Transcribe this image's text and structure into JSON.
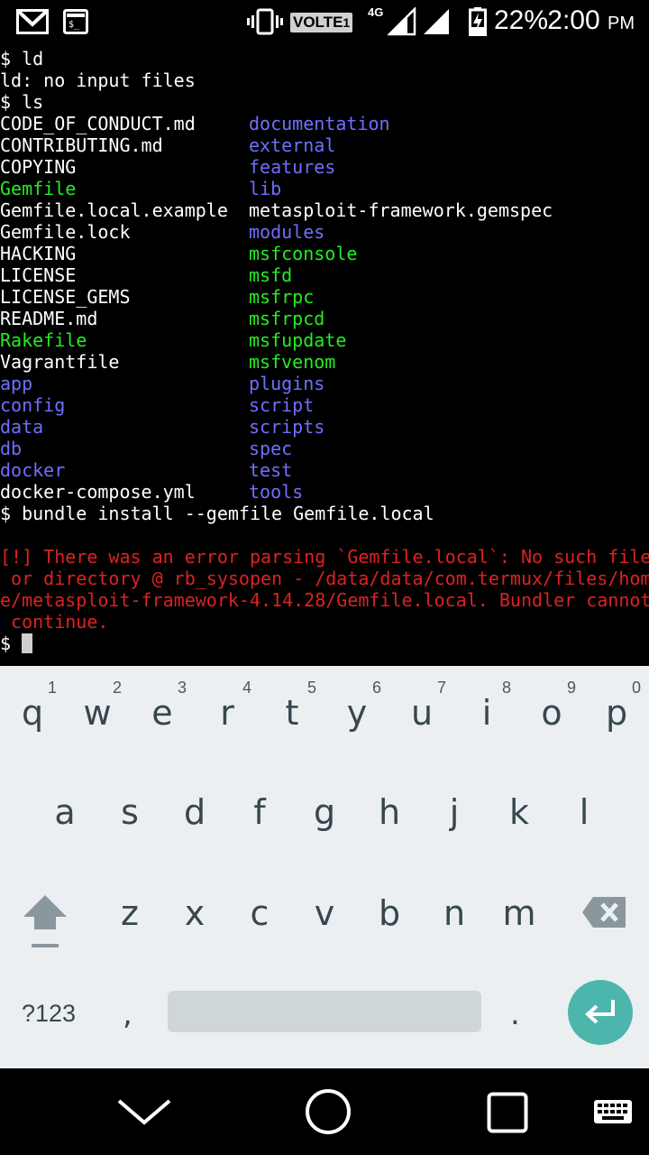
{
  "status_bar": {
    "volte": "VOLTE",
    "volte_sub": "1",
    "network": "4G",
    "battery_percent": "22%",
    "time": "2:00",
    "ampm": "PM",
    "icons": [
      "gmail-icon",
      "terminal-notification-icon",
      "vibrate-icon",
      "signal-icon",
      "signal-icon",
      "battery-charging-icon"
    ]
  },
  "terminal": {
    "lines": [
      {
        "c1": "$ ld",
        "c1_color": "white"
      },
      {
        "c1": "ld: no input files",
        "c1_color": "white"
      },
      {
        "c1": "$ ls",
        "c1_color": "white"
      },
      {
        "c1": "CODE_OF_CONDUCT.md",
        "c1_color": "white",
        "c2": "documentation",
        "c2_color": "blue"
      },
      {
        "c1": "CONTRIBUTING.md",
        "c1_color": "white",
        "c2": "external",
        "c2_color": "blue"
      },
      {
        "c1": "COPYING",
        "c1_color": "white",
        "c2": "features",
        "c2_color": "blue"
      },
      {
        "c1": "Gemfile",
        "c1_color": "green",
        "c2": "lib",
        "c2_color": "blue"
      },
      {
        "c1": "Gemfile.local.example",
        "c1_color": "white",
        "c2": "metasploit-framework.gemspec",
        "c2_color": "white"
      },
      {
        "c1": "Gemfile.lock",
        "c1_color": "white",
        "c2": "modules",
        "c2_color": "blue"
      },
      {
        "c1": "HACKING",
        "c1_color": "white",
        "c2": "msfconsole",
        "c2_color": "green"
      },
      {
        "c1": "LICENSE",
        "c1_color": "white",
        "c2": "msfd",
        "c2_color": "green"
      },
      {
        "c1": "LICENSE_GEMS",
        "c1_color": "white",
        "c2": "msfrpc",
        "c2_color": "green"
      },
      {
        "c1": "README.md",
        "c1_color": "white",
        "c2": "msfrpcd",
        "c2_color": "green"
      },
      {
        "c1": "Rakefile",
        "c1_color": "green",
        "c2": "msfupdate",
        "c2_color": "green"
      },
      {
        "c1": "Vagrantfile",
        "c1_color": "white",
        "c2": "msfvenom",
        "c2_color": "green"
      },
      {
        "c1": "app",
        "c1_color": "blue",
        "c2": "plugins",
        "c2_color": "blue"
      },
      {
        "c1": "config",
        "c1_color": "blue",
        "c2": "script",
        "c2_color": "blue"
      },
      {
        "c1": "data",
        "c1_color": "blue",
        "c2": "scripts",
        "c2_color": "blue"
      },
      {
        "c1": "db",
        "c1_color": "blue",
        "c2": "spec",
        "c2_color": "blue"
      },
      {
        "c1": "docker",
        "c1_color": "blue",
        "c2": "test",
        "c2_color": "blue"
      },
      {
        "c1": "docker-compose.yml",
        "c1_color": "white",
        "c2": "tools",
        "c2_color": "blue"
      },
      {
        "c1": "$ bundle install --gemfile Gemfile.local",
        "c1_color": "white"
      },
      {
        "c1": "",
        "c1_color": "white"
      },
      {
        "c1": "[!] There was an error parsing `Gemfile.local`: No such file",
        "c1_color": "red"
      },
      {
        "c1": " or directory @ rb_sysopen - /data/data/com.termux/files/hom",
        "c1_color": "red"
      },
      {
        "c1": "e/metasploit-framework-4.14.28/Gemfile.local. Bundler cannot",
        "c1_color": "red"
      },
      {
        "c1": " continue.",
        "c1_color": "red"
      }
    ],
    "prompt": "$"
  },
  "keyboard": {
    "row1": [
      {
        "key": "q",
        "hint": "1"
      },
      {
        "key": "w",
        "hint": "2"
      },
      {
        "key": "e",
        "hint": "3"
      },
      {
        "key": "r",
        "hint": "4"
      },
      {
        "key": "t",
        "hint": "5"
      },
      {
        "key": "y",
        "hint": "6"
      },
      {
        "key": "u",
        "hint": "7"
      },
      {
        "key": "i",
        "hint": "8"
      },
      {
        "key": "o",
        "hint": "9"
      },
      {
        "key": "p",
        "hint": "0"
      }
    ],
    "row2": [
      "a",
      "s",
      "d",
      "f",
      "g",
      "h",
      "j",
      "k",
      "l"
    ],
    "row3": [
      "z",
      "x",
      "c",
      "v",
      "b",
      "n",
      "m"
    ],
    "symbols_label": "?123",
    "comma": ",",
    "period": ".",
    "enter_color": "#4db6ac",
    "shift_icon": "shift-icon",
    "backspace_icon": "backspace-icon"
  },
  "nav_bar": {
    "icons": [
      "back-chevron-icon",
      "home-circle-icon",
      "recents-square-icon",
      "keyboard-switch-icon"
    ]
  }
}
